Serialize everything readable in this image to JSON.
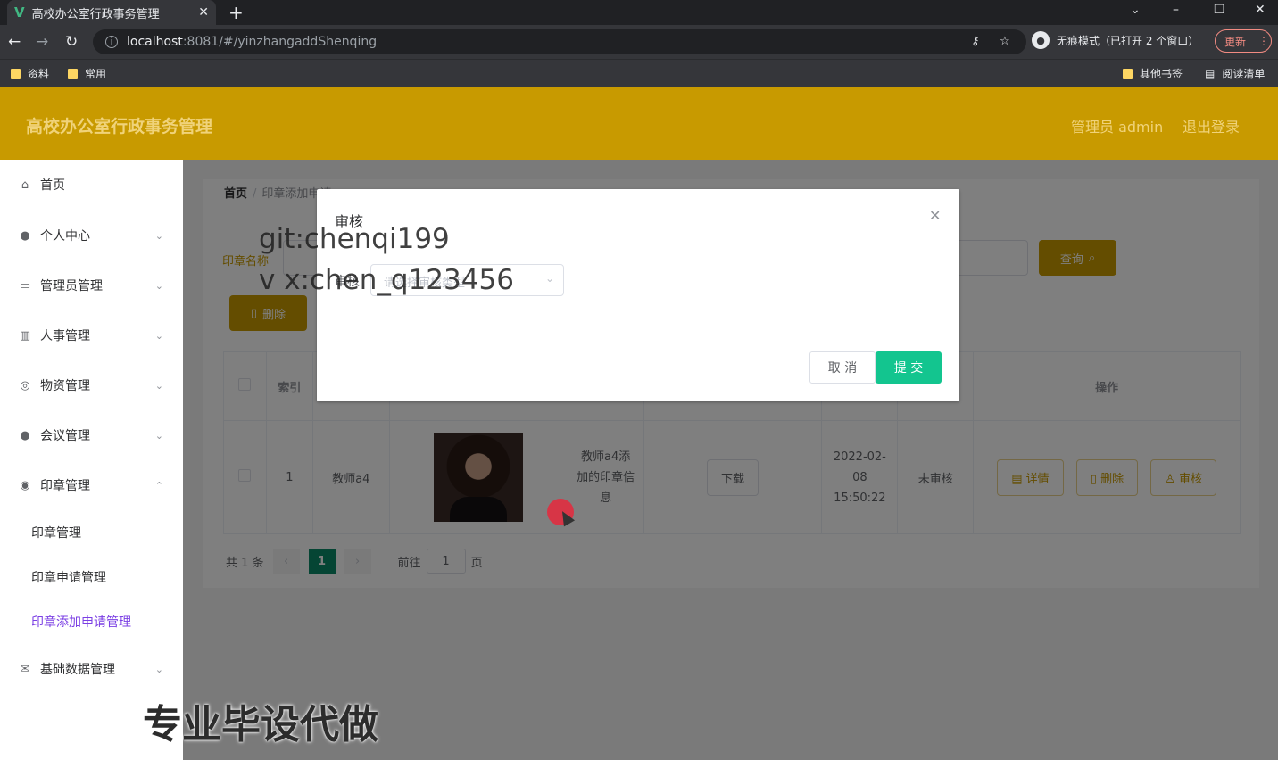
{
  "browser": {
    "tab_title": "高校办公室行政事务管理",
    "url_host": "localhost",
    "url_path": ":8081/#/yinzhangaddShenqing",
    "incognito_label": "无痕模式（已打开 2 个窗口）",
    "update_label": "更新",
    "bookmarks": [
      "资料",
      "常用"
    ],
    "bookmarks_right": [
      "其他书签",
      "阅读清单"
    ]
  },
  "header": {
    "brand": "高校办公室行政事务管理",
    "user": "管理员 admin",
    "logout": "退出登录"
  },
  "sidebar": {
    "items": [
      {
        "label": "首页",
        "icon": "home-icon"
      },
      {
        "label": "个人中心",
        "icon": "user-icon"
      },
      {
        "label": "管理员管理",
        "icon": "id-card-icon"
      },
      {
        "label": "人事管理",
        "icon": "book-icon"
      },
      {
        "label": "物资管理",
        "icon": "compass-icon"
      },
      {
        "label": "会议管理",
        "icon": "bulb-icon"
      },
      {
        "label": "印章管理",
        "icon": "stamp-icon"
      },
      {
        "label": "基础数据管理",
        "icon": "mail-icon"
      }
    ],
    "sub_items": [
      "印章管理",
      "印章申请管理",
      "印章添加申请管理"
    ]
  },
  "breadcrumb": {
    "home": "首页",
    "current": "印章添加申请"
  },
  "search": {
    "label": "印章名称",
    "button": "查询"
  },
  "toolbar": {
    "delete": "删除"
  },
  "table": {
    "headers": {
      "index": "索引",
      "ops": "操作"
    },
    "row": {
      "index": "1",
      "name": "教师a4",
      "desc": "教师a4添加的印章信息",
      "download": "下载",
      "time": "2022-02-08 15:50:22",
      "status": "未审核",
      "detail": "详情",
      "delete": "删除",
      "review": "审核"
    }
  },
  "pager": {
    "total": "共 1 条",
    "page": "1",
    "goto_prefix": "前往",
    "goto_value": "1",
    "goto_suffix": "页"
  },
  "dialog": {
    "title": "审核",
    "field_label": "审核",
    "select_placeholder": "请选择审核类型",
    "cancel": "取 消",
    "submit": "提 交"
  },
  "watermarks": {
    "line1": "git:chenqi199",
    "line2": "v x:chen_q123456",
    "bottom": "专业毕设代做"
  }
}
